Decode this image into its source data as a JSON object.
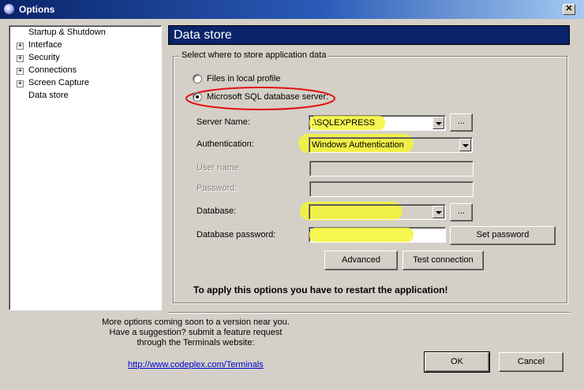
{
  "window": {
    "title": "Options"
  },
  "tree": {
    "items": [
      {
        "label": "Startup & Shutdown",
        "expandable": false
      },
      {
        "label": "Interface",
        "expandable": true
      },
      {
        "label": "Security",
        "expandable": true
      },
      {
        "label": "Connections",
        "expandable": true
      },
      {
        "label": "Screen Capture",
        "expandable": true
      },
      {
        "label": "Data store",
        "expandable": false
      }
    ]
  },
  "panel": {
    "title": "Data store",
    "group_label": "Select where to store application data",
    "option_local": "Files in local profile",
    "option_sql": "Microsoft SQL database server:",
    "server_name_label": "Server Name:",
    "server_name_value": ".\\SQLEXPRESS",
    "authentication_label": "Authentication:",
    "authentication_value": "Windows Authentication",
    "username_label": "User name:",
    "password_label": "Password:",
    "database_label": "Database:",
    "database_value": "",
    "db_password_label": "Database password:",
    "browse_label": "...",
    "set_password_label": "Set password",
    "advanced_label": "Advanced",
    "test_connection_label": "Test connection",
    "restart_note": "To apply this options you have to restart the application!"
  },
  "footer": {
    "more_line1": "More options coming soon to a version near you.",
    "more_line2": "Have a suggestion? submit a feature request",
    "more_line3": "through the Terminals website:",
    "link": "http://www.codeplex.com/Terminals",
    "ok_label": "OK",
    "cancel_label": "Cancel"
  },
  "colors": {
    "title_bar": "#0a246a",
    "highlight": "#f5f532",
    "annotation_circle": "#e01010"
  },
  "icons": {
    "app": "terminals-app-icon",
    "close": "close-icon",
    "expand": "plus-icon",
    "dropdown": "chevron-down-icon"
  }
}
